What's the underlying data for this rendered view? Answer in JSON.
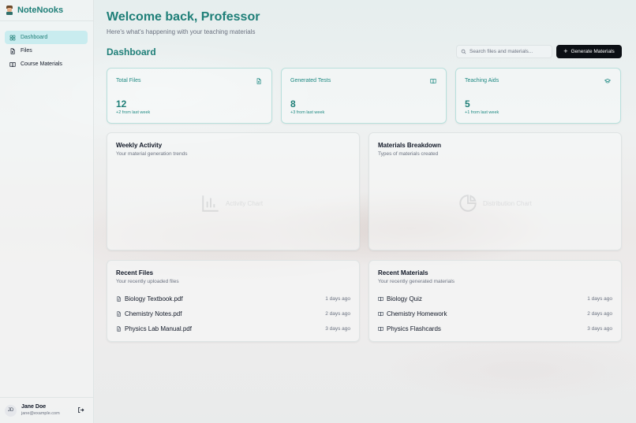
{
  "app": {
    "name": "NoteNooks"
  },
  "sidebar": {
    "items": [
      {
        "label": "Dashboard",
        "active": true
      },
      {
        "label": "Files",
        "active": false
      },
      {
        "label": "Course Materials",
        "active": false
      }
    ]
  },
  "user": {
    "initials": "JD",
    "name": "Jane Doe",
    "email": "jane@example.com"
  },
  "header": {
    "welcome": "Welcome back, Professor",
    "subtitle": "Here's what's happening with your teaching materials"
  },
  "dashboard": {
    "title": "Dashboard",
    "search_placeholder": "Search files and materials...",
    "generate_label": "Generate Materials",
    "stats": [
      {
        "label": "Total Files",
        "value": "12",
        "delta": "+2 from last week",
        "icon": "file-icon"
      },
      {
        "label": "Generated Tests",
        "value": "8",
        "delta": "+3 from last week",
        "icon": "book-open-icon"
      },
      {
        "label": "Teaching Aids",
        "value": "5",
        "delta": "+1 from last week",
        "icon": "graduation-cap-icon"
      }
    ],
    "weekly_activity": {
      "title": "Weekly Activity",
      "subtitle": "Your material generation trends",
      "placeholder": "Activity Chart"
    },
    "materials_breakdown": {
      "title": "Materials Breakdown",
      "subtitle": "Types of materials created",
      "placeholder": "Distribution Chart"
    },
    "recent_files": {
      "title": "Recent Files",
      "subtitle": "Your recently uploaded files",
      "items": [
        {
          "name": "Biology Textbook.pdf",
          "when": "1 days ago"
        },
        {
          "name": "Chemistry Notes.pdf",
          "when": "2 days ago"
        },
        {
          "name": "Physics Lab Manual.pdf",
          "when": "3 days ago"
        }
      ]
    },
    "recent_materials": {
      "title": "Recent Materials",
      "subtitle": "Your recently generated materials",
      "items": [
        {
          "name": "Biology Quiz",
          "when": "1 days ago"
        },
        {
          "name": "Chemistry Homework",
          "when": "2 days ago"
        },
        {
          "name": "Physics Flashcards",
          "when": "3 days ago"
        }
      ]
    }
  },
  "colors": {
    "accent": "#1f7f78",
    "active_bg": "#c9ecef",
    "button_bg": "#0b0f14"
  }
}
